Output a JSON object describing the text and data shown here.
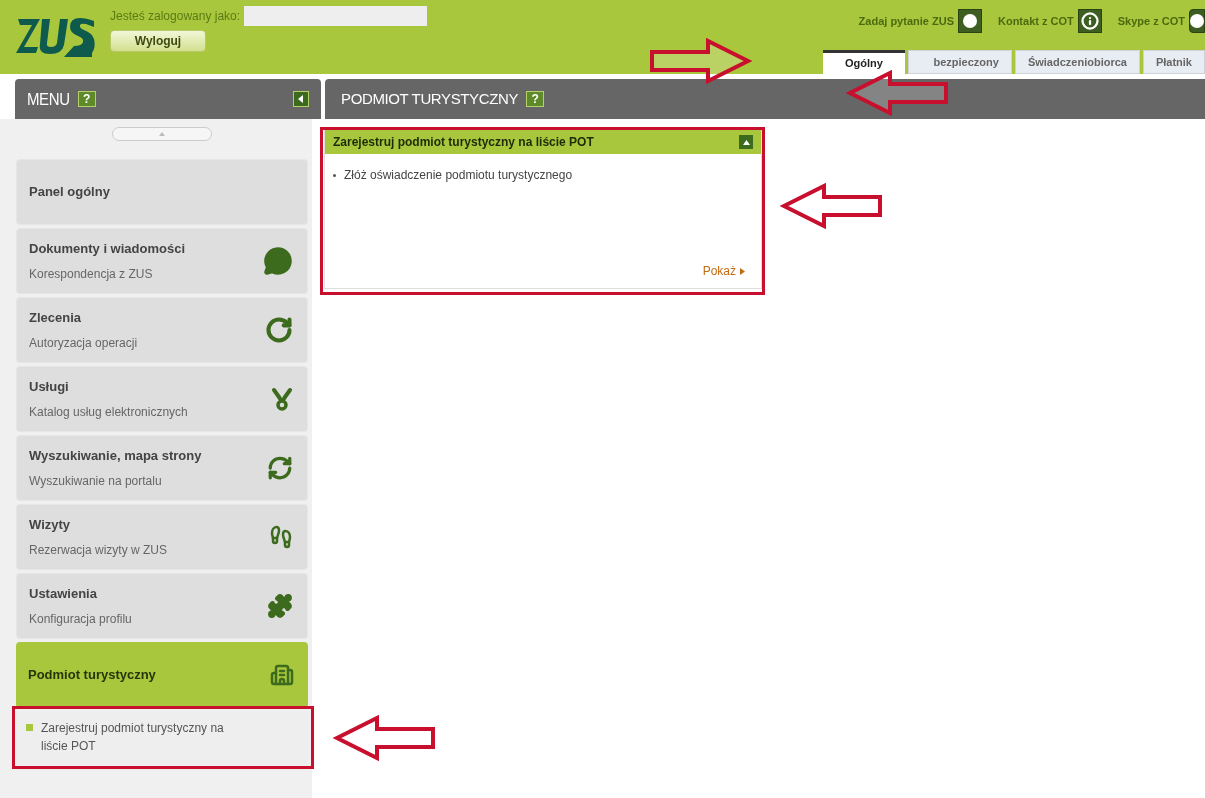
{
  "header": {
    "logged_label": "Jesteś zalogowany jako:",
    "logout_button": "Wyloguj",
    "links": [
      {
        "label": "Zadaj pytanie ZUS"
      },
      {
        "label": "Kontakt z COT"
      },
      {
        "label": "Skype z COT"
      }
    ]
  },
  "tabs": [
    {
      "label": "Ogólny",
      "selected": true
    },
    {
      "label": "bezpieczony",
      "selected": false
    },
    {
      "label": "Świadczeniobiorca",
      "selected": false
    },
    {
      "label": "Płatnik",
      "selected": false
    }
  ],
  "menu": {
    "title": "MENU",
    "help": "?",
    "items": [
      {
        "title": "Panel ogólny",
        "selected": false
      },
      {
        "title": "Dokumenty i wiadomości",
        "subtitle": "Korespondencja z ZUS",
        "selected": false
      },
      {
        "title": "Zlecenia",
        "subtitle": "Autoryzacja operacji",
        "selected": false
      },
      {
        "title": "Usługi",
        "subtitle": "Katalog usług elektronicznych",
        "selected": false
      },
      {
        "title": "Wyszukiwanie, mapa strony",
        "subtitle": "Wyszukiwanie na portalu",
        "selected": false
      },
      {
        "title": "Wizyty",
        "subtitle": "Rezerwacja wizyty w ZUS",
        "selected": false
      },
      {
        "title": "Ustawienia",
        "subtitle": "Konfiguracja profilu",
        "selected": false
      },
      {
        "title": "Podmiot turystyczny",
        "selected": true,
        "children": [
          {
            "title": "Zarejestruj podmiot turystyczny na liście POT"
          }
        ]
      }
    ]
  },
  "content": {
    "title": "PODMIOT TURYSTYCZNY",
    "help": "?",
    "card": {
      "title": "Zarejestruj podmiot turystyczny na liście POT",
      "items": [
        "Złóż oświadczenie podmiotu turystycznego"
      ],
      "link": "Pokaż"
    }
  }
}
